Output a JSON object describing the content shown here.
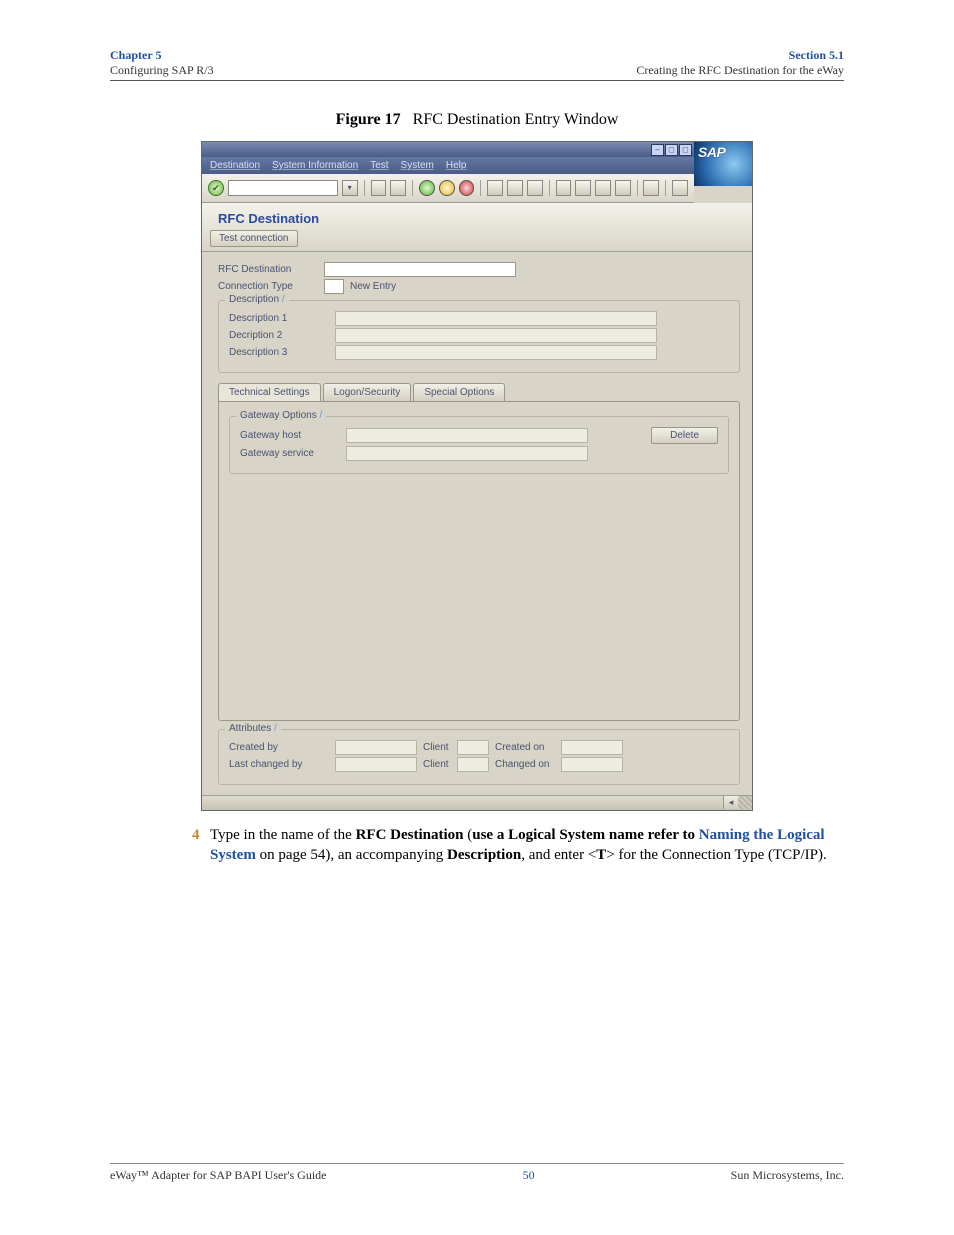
{
  "header": {
    "chapter": "Chapter 5",
    "chapter_sub": "Configuring SAP R/3",
    "section": "Section 5.1",
    "section_sub": "Creating the RFC Destination for the eWay"
  },
  "figure": {
    "label": "Figure 17",
    "caption": "RFC Destination Entry Window"
  },
  "sap": {
    "logo": "SAP",
    "menu": [
      "Destination",
      "System Information",
      "Test",
      "System",
      "Help"
    ],
    "window_title": "RFC Destination",
    "button_test": "Test connection",
    "labels": {
      "rfc_dest": "RFC Destination",
      "conn_type": "Connection Type",
      "conn_type_val_label": "New Entry"
    },
    "desc_group": "Description",
    "desc1": "Description 1",
    "desc2": "Decription 2",
    "desc3": "Description 3",
    "tabs": [
      "Technical Settings",
      "Logon/Security",
      "Special Options"
    ],
    "gateway_group": "Gateway Options",
    "gw_host": "Gateway host",
    "gw_service": "Gateway service",
    "delete_btn": "Delete",
    "attr_group": "Attributes",
    "created_by": "Created by",
    "last_changed_by": "Last changed by",
    "client": "Client",
    "created_on": "Created on",
    "changed_on": "Changed on"
  },
  "body": {
    "step_num": "4",
    "t1": "Type in the name of the ",
    "b1": "RFC Destination",
    "t2": " (",
    "b2": "use a Logical System name refer to ",
    "link": "Naming the Logical System",
    "t3": " on page 54), an accompanying ",
    "b3": "Description",
    "t4": ", and enter <",
    "b4": "T",
    "t5": "> for the Connection Type (TCP/IP)."
  },
  "footer": {
    "left": "eWay™ Adapter for SAP BAPI User's Guide",
    "page": "50",
    "right": "Sun Microsystems, Inc."
  }
}
